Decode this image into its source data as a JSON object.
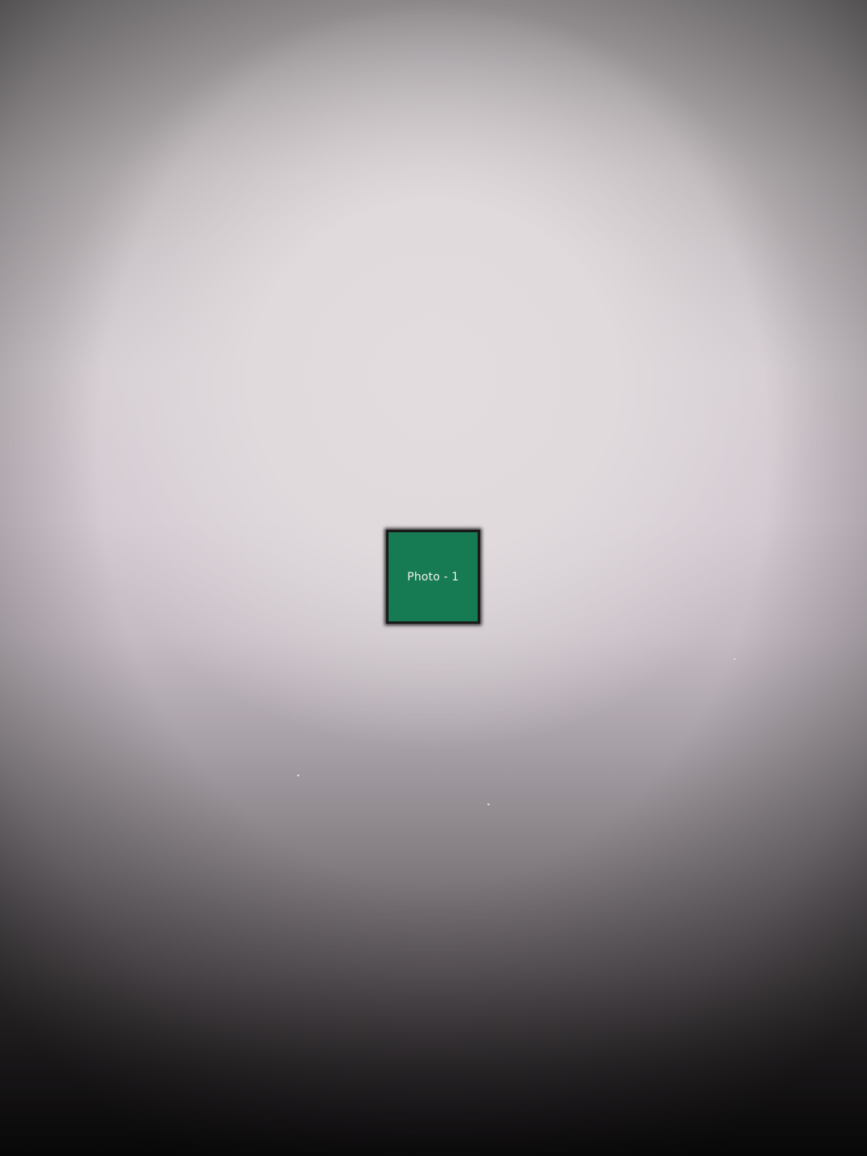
{
  "canvas": {
    "tile": {
      "label": "Photo - 1",
      "color": "#167a52"
    }
  }
}
